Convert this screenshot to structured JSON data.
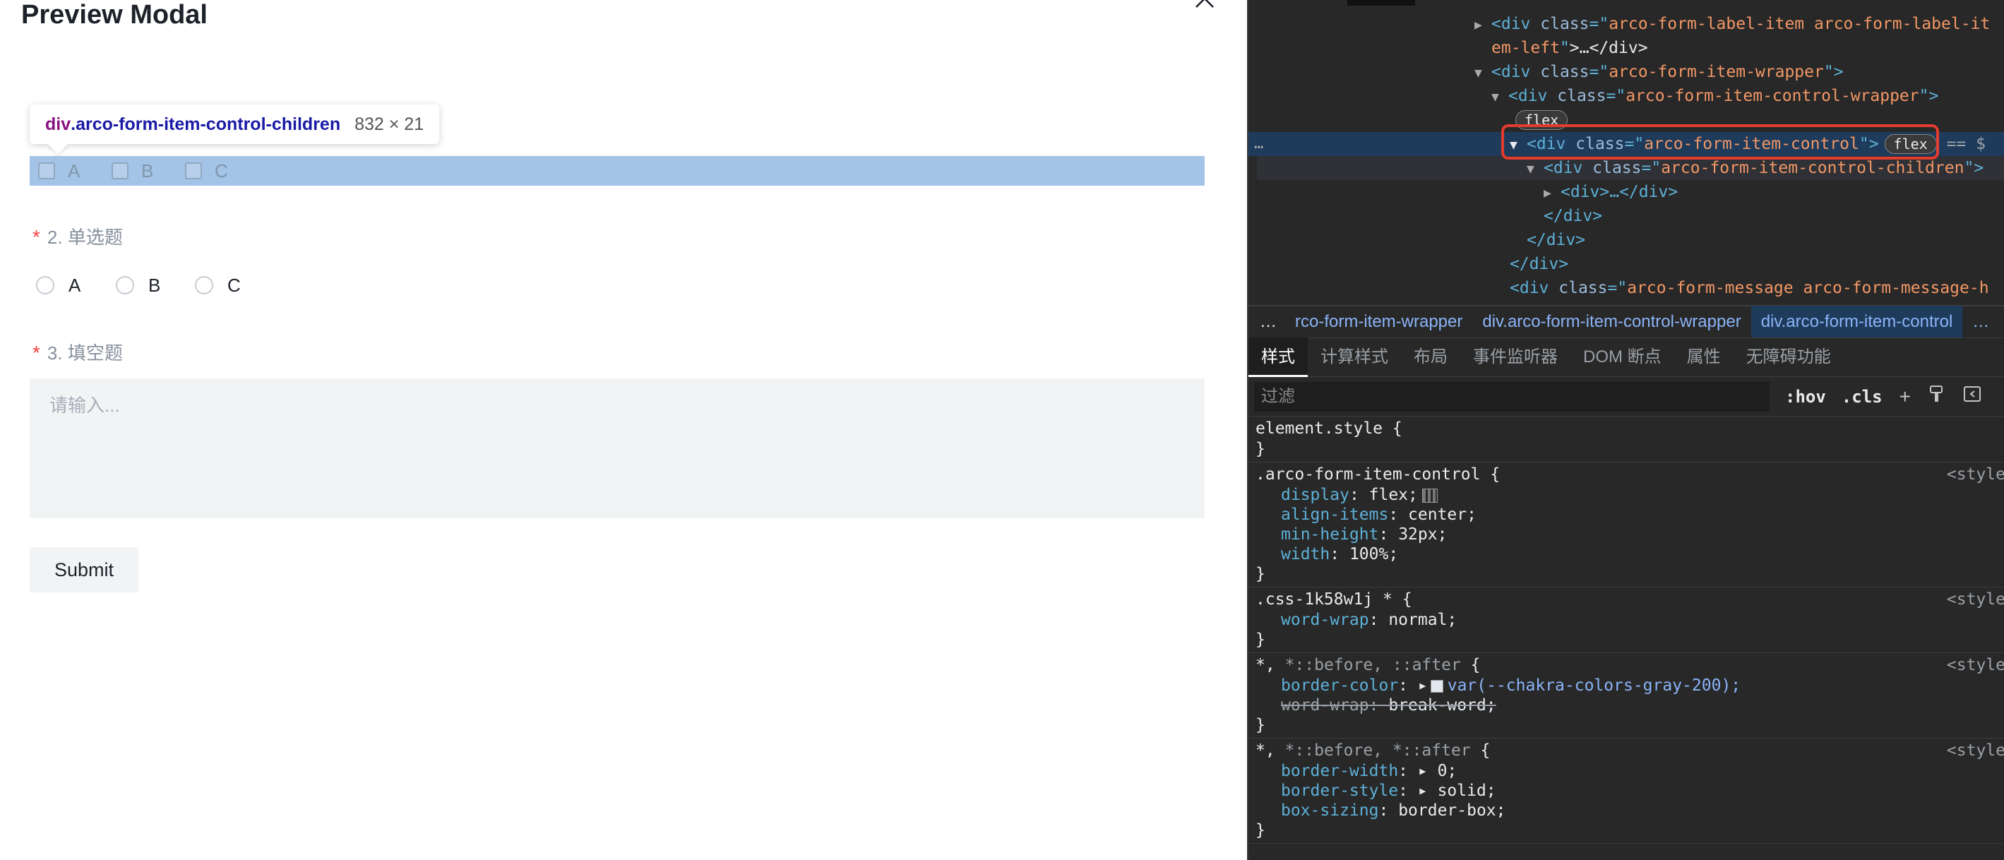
{
  "modal": {
    "title": "Preview Modal",
    "tooltip": {
      "tag": "div",
      "class": ".arco-form-item-control-children",
      "size": "832 × 21"
    },
    "q1_options": [
      "A",
      "B",
      "C"
    ],
    "q2": {
      "star": "*",
      "label": "2. 单选题",
      "options": [
        "A",
        "B",
        "C"
      ]
    },
    "q3": {
      "star": "*",
      "label": "3. 填空题",
      "placeholder": "请输入..."
    },
    "submit_label": "Submit"
  },
  "devtools": {
    "dom": {
      "line0": "arco-form-label-item arco-form-label-it",
      "line0b": "em-left",
      "line0c": ">…</div>",
      "wrapper": "arco-form-item-wrapper",
      "control_wrapper": "arco-form-item-control-wrapper",
      "flex_badge": "flex",
      "control": "arco-form-item-control",
      "control_eq": "== $",
      "children": "arco-form-item-control-children",
      "div_ellipsis": "<div>…</div>",
      "close_div": "</div>",
      "message": "arco-form-message arco-form-message-h",
      "gutter_dots": "…"
    },
    "breadcrumb": {
      "dots": "…",
      "items": [
        "rco-form-item-wrapper",
        "div.arco-form-item-control-wrapper",
        "div.arco-form-item-control",
        "…"
      ]
    },
    "tabs": [
      "样式",
      "计算样式",
      "布局",
      "事件监听器",
      "DOM 断点",
      "属性",
      "无障碍功能"
    ],
    "filter": {
      "placeholder": "过滤",
      "hov": ":hov",
      "cls": ".cls",
      "plus": "+"
    },
    "styles": {
      "element_style": "element.style",
      "rule1_selector": ".arco-form-item-control",
      "rule1_props": [
        {
          "name": "display",
          "value": "flex;"
        },
        {
          "name": "align-items",
          "value": "center;"
        },
        {
          "name": "min-height",
          "value": "32px;"
        },
        {
          "name": "width",
          "value": "100%;"
        }
      ],
      "rule2_selector": ".css-1k58w1j *",
      "rule2_props": [
        {
          "name": "word-wrap",
          "value": "normal;"
        }
      ],
      "rule3_selector_a": "*,",
      "rule3_selector_b": "*::before, ::after",
      "rule3_props": [
        {
          "name": "border-color",
          "value": "var(--chakra-colors-gray-200);"
        },
        {
          "name": "word-wrap",
          "value": "break-word;"
        }
      ],
      "rule4_selector_a": "*,",
      "rule4_selector_b": "*::before, *::after",
      "rule4_props": [
        {
          "name": "border-width",
          "value": "0;"
        },
        {
          "name": "border-style",
          "value": "solid;"
        },
        {
          "name": "box-sizing",
          "value": "border-box;"
        }
      ],
      "source": "<style",
      "open_brace": "{",
      "close_brace": "}"
    }
  }
}
